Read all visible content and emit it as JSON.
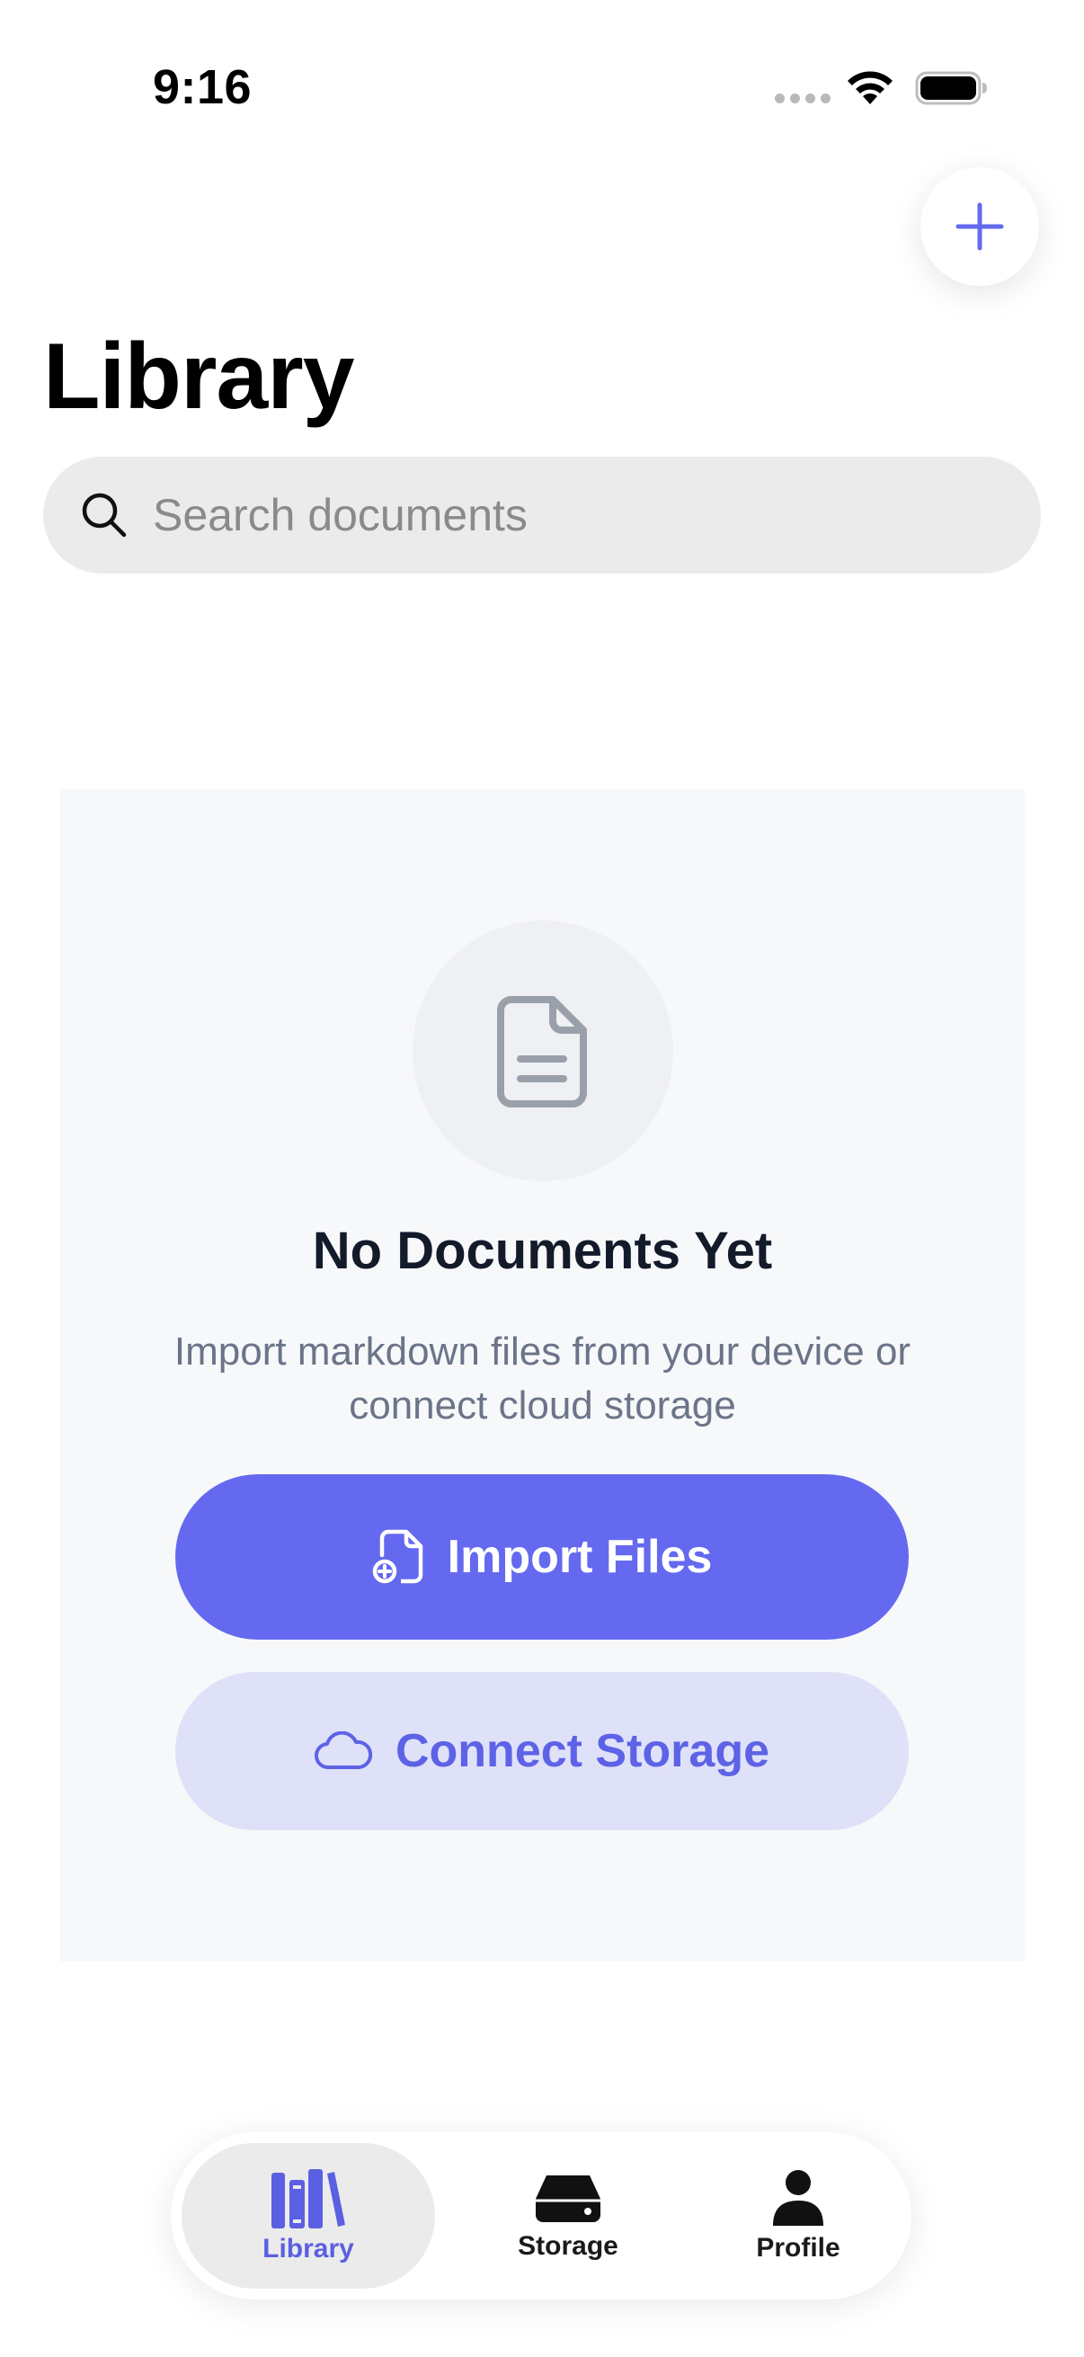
{
  "status_bar": {
    "time": "9:16"
  },
  "header": {
    "title": "Library",
    "add_button_icon": "plus-icon"
  },
  "search": {
    "placeholder": "Search documents"
  },
  "empty_state": {
    "icon": "document-icon",
    "title": "No Documents Yet",
    "description": "Import markdown files from your device or connect cloud storage",
    "import_button_label": "Import Files",
    "connect_button_label": "Connect Storage"
  },
  "tab_bar": {
    "tabs": [
      {
        "label": "Library",
        "icon": "books-icon",
        "active": true
      },
      {
        "label": "Storage",
        "icon": "drive-icon",
        "active": false
      },
      {
        "label": "Profile",
        "icon": "person-icon",
        "active": false
      }
    ]
  },
  "colors": {
    "accent": "#6469ef",
    "accent_soft": "#dfe1f8",
    "title_text": "#131a2a",
    "muted_text": "#6b7488",
    "card_background": "#f7f8fa"
  }
}
